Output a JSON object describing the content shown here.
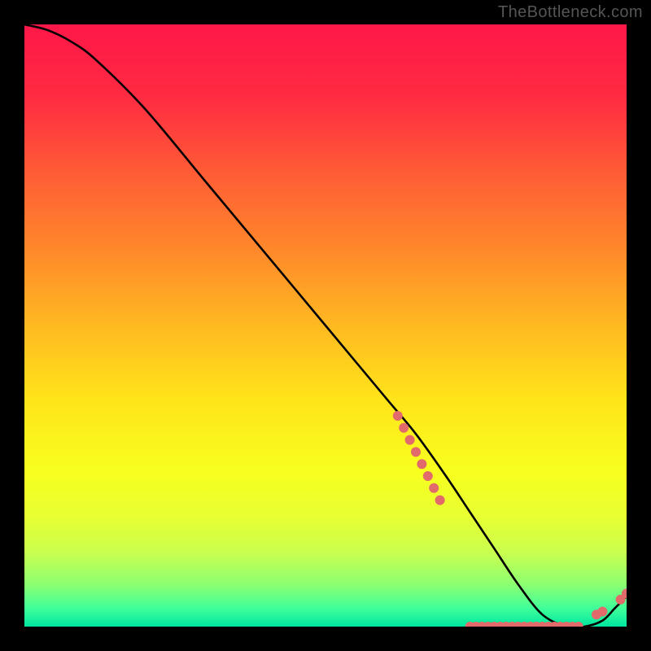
{
  "watermark": "TheBottleneck.com",
  "chart_data": {
    "type": "line",
    "title": "",
    "xlabel": "",
    "ylabel": "",
    "xlim": [
      0,
      100
    ],
    "ylim": [
      0,
      100
    ],
    "grid": false,
    "legend": false,
    "curve": {
      "name": "bottleneck-curve",
      "x": [
        0,
        4,
        8,
        12,
        20,
        30,
        40,
        50,
        60,
        65,
        70,
        74,
        78,
        82,
        86,
        90,
        93,
        96,
        98,
        100
      ],
      "values": [
        100,
        99,
        97,
        94,
        86,
        74,
        62,
        50,
        38,
        32,
        25,
        19,
        13,
        7,
        2,
        0,
        0,
        1,
        3,
        5
      ]
    },
    "series": [
      {
        "name": "marker-cluster-left",
        "type": "scatter",
        "x": [
          62,
          63,
          64,
          65,
          66,
          67,
          68,
          69
        ],
        "values": [
          35,
          33,
          31,
          29,
          27,
          25,
          23,
          21
        ]
      },
      {
        "name": "marker-flat-bottom",
        "type": "scatter",
        "x": [
          74,
          75,
          76,
          77,
          78,
          79,
          80,
          81,
          82,
          83,
          84,
          85,
          86,
          87,
          88,
          89,
          90,
          91,
          92
        ],
        "values": [
          0,
          0,
          0,
          0,
          0,
          0,
          0,
          0,
          0,
          0,
          0,
          0,
          0,
          0,
          0,
          0,
          0,
          0,
          0
        ]
      },
      {
        "name": "marker-right-rise",
        "type": "scatter",
        "x": [
          95,
          96,
          99,
          100
        ],
        "values": [
          2,
          2.5,
          4.5,
          5.5
        ]
      }
    ],
    "background_gradient": {
      "stops": [
        {
          "offset": 0.0,
          "color": "#ff1748"
        },
        {
          "offset": 0.12,
          "color": "#ff2b42"
        },
        {
          "offset": 0.25,
          "color": "#ff5d35"
        },
        {
          "offset": 0.38,
          "color": "#ff8a2a"
        },
        {
          "offset": 0.5,
          "color": "#ffb921"
        },
        {
          "offset": 0.62,
          "color": "#ffe31a"
        },
        {
          "offset": 0.74,
          "color": "#f8ff1e"
        },
        {
          "offset": 0.82,
          "color": "#e7ff33"
        },
        {
          "offset": 0.88,
          "color": "#c7ff50"
        },
        {
          "offset": 0.93,
          "color": "#8cff72"
        },
        {
          "offset": 0.97,
          "color": "#3fff9a"
        },
        {
          "offset": 1.0,
          "color": "#00e6a0"
        }
      ]
    },
    "curve_color": "#000000",
    "marker_color": "#e26a6a",
    "marker_radius_px": 6
  }
}
